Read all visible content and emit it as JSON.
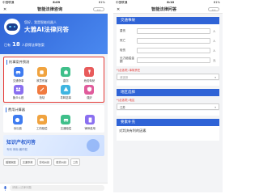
{
  "left": {
    "status": {
      "carrier": "中国联通",
      "time": "8:09",
      "battery": "81%"
    },
    "nav": {
      "title": "智能法律咨询",
      "menu_label": "•••",
      "close_label": "◎"
    },
    "hero": {
      "greeting": "您好，我是智能机器人",
      "headline": "大雅AI法律问答",
      "stat_prefix": "已有",
      "stat_number": "18",
      "stat_suffix": "人获得法律答案"
    },
    "calc_panel": {
      "title": "刑事案件预测",
      "items": [
        {
          "label": "交通肇事",
          "icon": "car-icon",
          "color": "#3f7cf0"
        },
        {
          "label": "故意伤害",
          "icon": "fist-icon",
          "color": "#f0a33f"
        },
        {
          "label": "盗窃",
          "icon": "bag-icon",
          "color": "#3fbf8a"
        },
        {
          "label": "危险驾驶",
          "icon": "wine-icon",
          "color": "#e85b5b"
        },
        {
          "label": "聚众斗殴",
          "icon": "group-icon",
          "color": "#8a6ff0"
        },
        {
          "label": "抢劫",
          "icon": "knife-icon",
          "color": "#f07a3f"
        },
        {
          "label": "寻衅滋事",
          "icon": "alert-icon",
          "color": "#3fb4e0"
        },
        {
          "label": "强奸",
          "icon": "shield-icon",
          "color": "#e05b9b"
        }
      ]
    },
    "fee_panel": {
      "title": "费用计算器",
      "items": [
        {
          "label": "诉讼费",
          "icon": "coin-icon",
          "color": "#3f7cf0"
        },
        {
          "label": "工伤赔偿",
          "icon": "helmet-icon",
          "color": "#f0a33f"
        },
        {
          "label": "交通赔偿",
          "icon": "car-icon",
          "color": "#3fbf8a"
        },
        {
          "label": "律师费用",
          "icon": "doc-icon",
          "color": "#8a6ff0"
        }
      ]
    },
    "ip_banner": {
      "title": "知识产权问答",
      "subtitle": "专利 商标 著作权"
    },
    "chips": [
      "婚姻家庭",
      "交通事故",
      "劳动纠纷",
      "借贷纠纷",
      "工伤"
    ],
    "input_placeholder": "请输入法律问题"
  },
  "right": {
    "status": {
      "carrier": "中国联通",
      "time": "8:10",
      "battery": "81%"
    },
    "nav": {
      "title": "智能法律问答",
      "menu_label": "•••",
      "close_label": "◎"
    },
    "section1": "交通事故",
    "rows": [
      {
        "label": "重伤",
        "unit": "人"
      },
      {
        "label": "死亡",
        "unit": "人"
      },
      {
        "label": "轻伤",
        "unit": "人"
      },
      {
        "label": "无力赔偿金额",
        "unit": "元"
      }
    ],
    "note1": "*(必选项) 事故责任",
    "select1": "请选择",
    "section2": "地区选择",
    "note2": "*(必选项) 地区",
    "select2": "江苏",
    "section3": "要素补充",
    "bottom_text": "对判决有利的因素"
  },
  "colors": {
    "primary": "#2f63d6",
    "alert": "#e53935"
  }
}
